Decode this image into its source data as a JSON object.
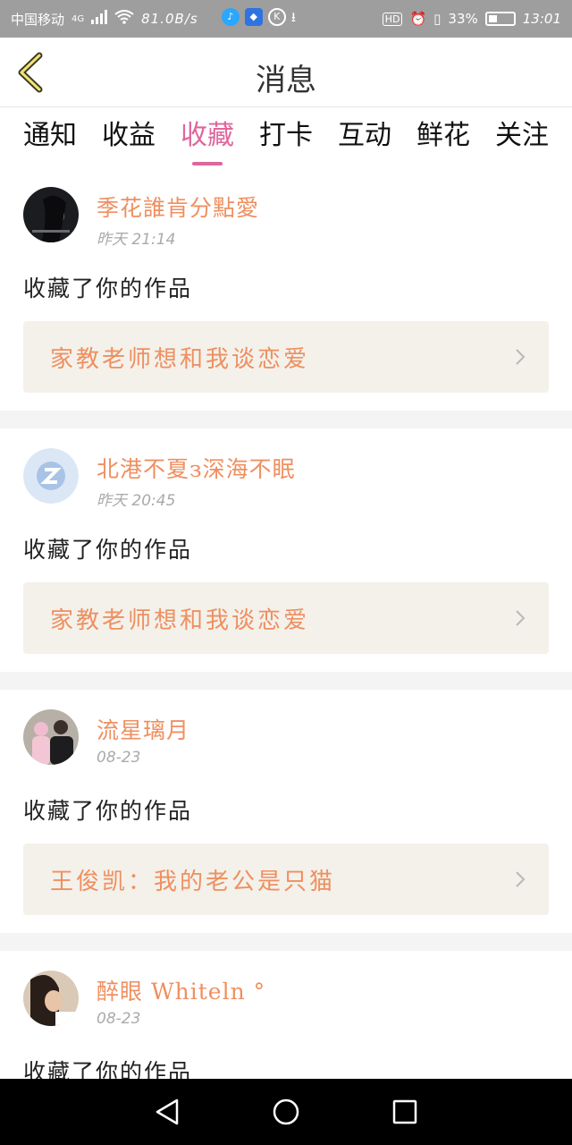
{
  "status_bar": {
    "carrier": "中国移动",
    "network": "4G",
    "speed": "81.0B/s",
    "battery": "33%",
    "time": "13:01",
    "hd": "HD"
  },
  "header": {
    "title": "消息",
    "back_icon": "chevron-left-icon"
  },
  "tabs": [
    {
      "label": "通知",
      "active": false
    },
    {
      "label": "收益",
      "active": false
    },
    {
      "label": "收藏",
      "active": true
    },
    {
      "label": "打卡",
      "active": false
    },
    {
      "label": "互动",
      "active": false
    },
    {
      "label": "鲜花",
      "active": false
    },
    {
      "label": "关注",
      "active": false
    }
  ],
  "messages": [
    {
      "user": "季花誰肯分點愛",
      "time": "昨天  21:14",
      "action": "收藏了你的作品",
      "work": "家教老师想和我谈恋爱"
    },
    {
      "user": "北港不夏з深海不眠",
      "time": "昨天  20:45",
      "action": "收藏了你的作品",
      "work": "家教老师想和我谈恋爱"
    },
    {
      "user": "流星璃月",
      "time": "08-23",
      "action": "收藏了你的作品",
      "work": "王俊凯：我的老公是只猫"
    },
    {
      "user": "醉眼 Whiteln °",
      "time": "08-23",
      "action": "收藏了你的作品",
      "work": ""
    }
  ],
  "colors": {
    "accent": "#e0669c",
    "username": "#ef8f60",
    "card_bg": "#f3f1ea"
  }
}
